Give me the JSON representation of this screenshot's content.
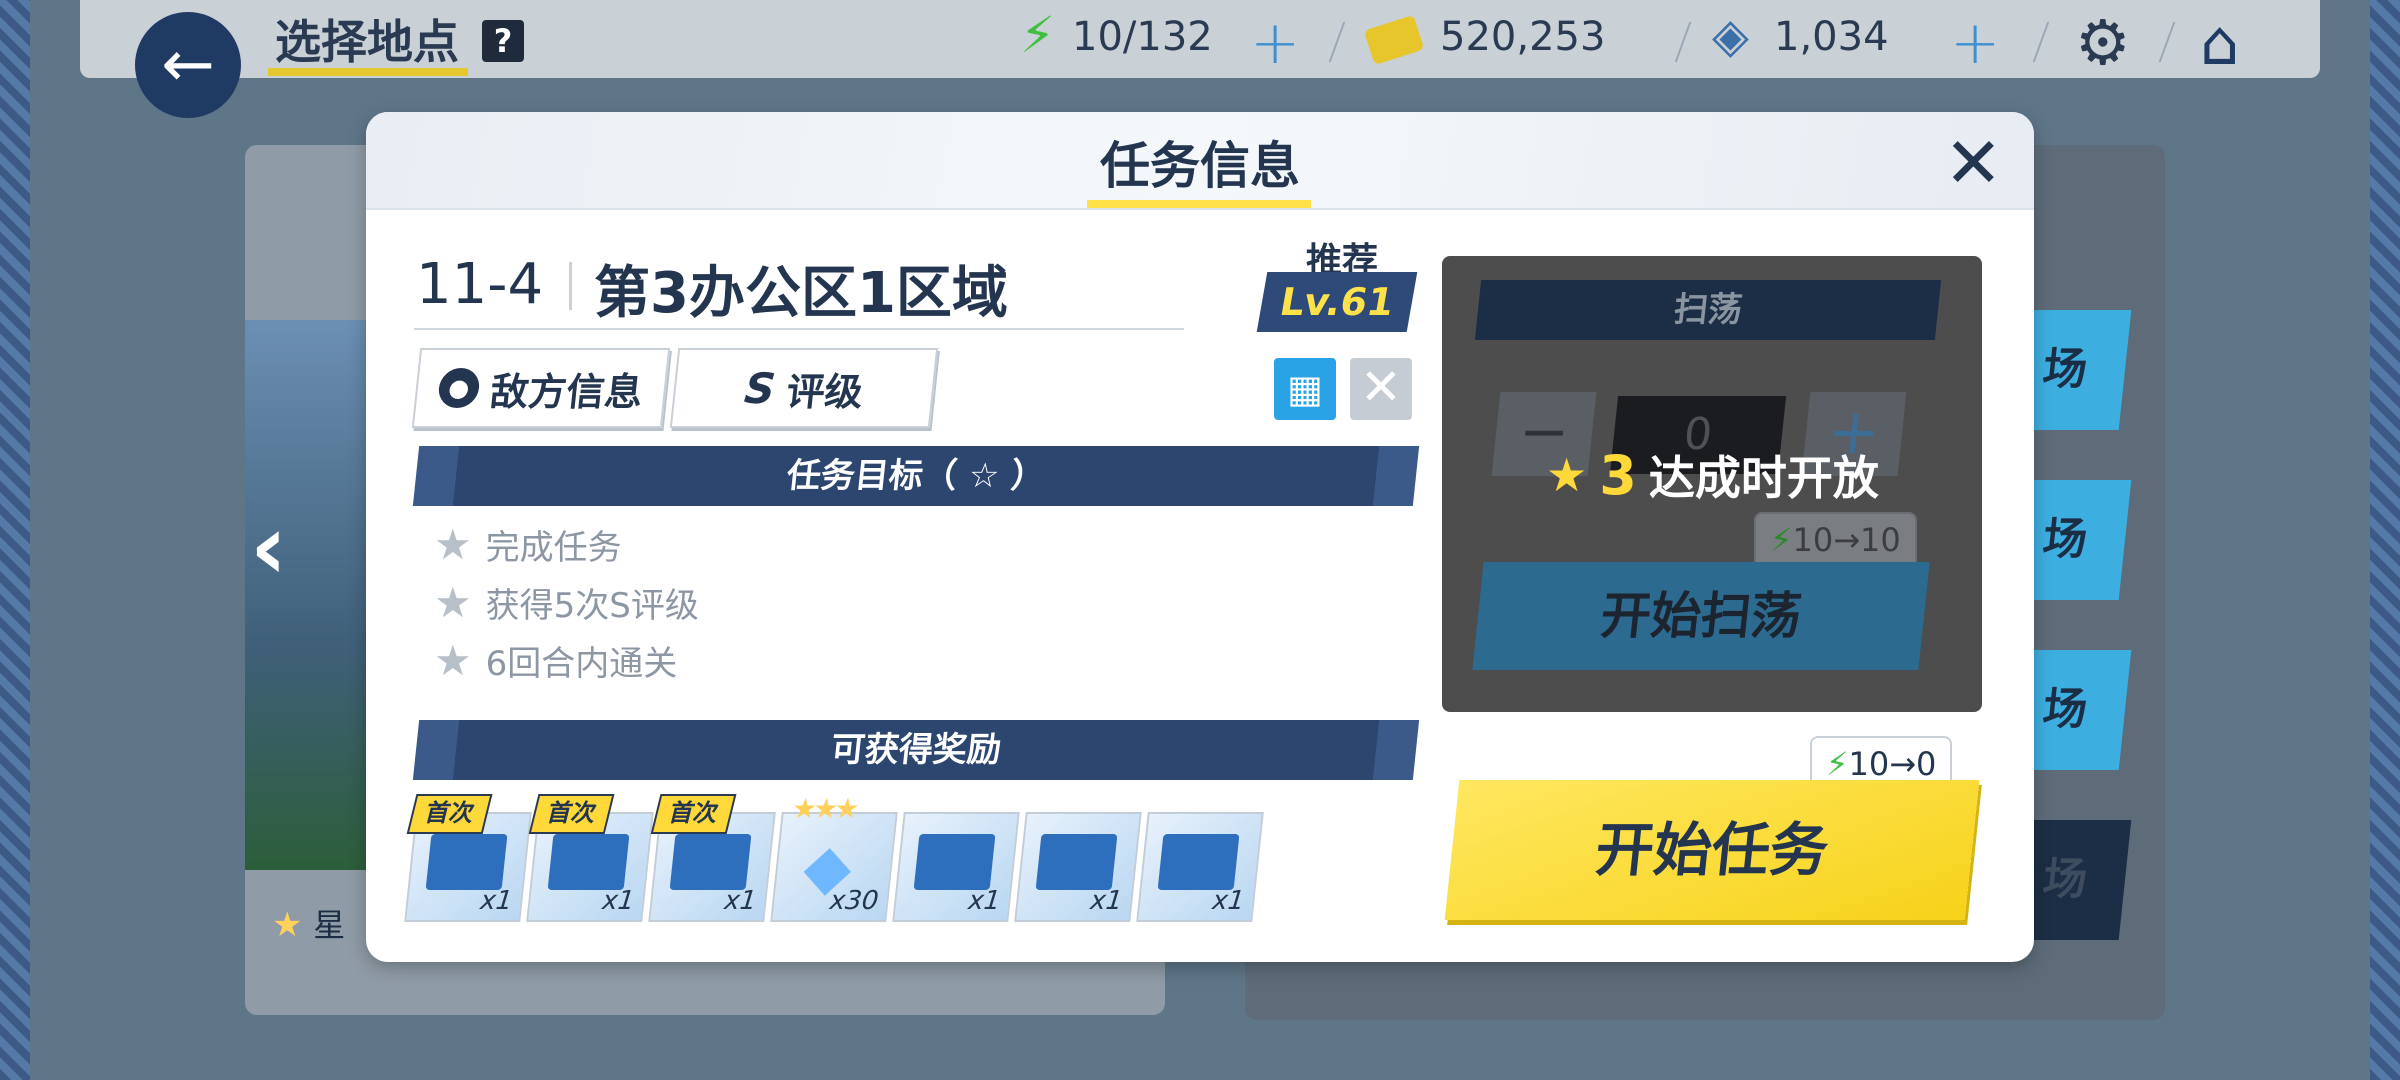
{
  "topbar": {
    "location_title": "选择地点",
    "help_icon": "?",
    "ap": "10/132",
    "credits": "520,253",
    "gems": "1,034"
  },
  "background": {
    "left_star_label": "星",
    "right_button_label": "场"
  },
  "modal": {
    "title": "任务信息",
    "stage_code": "11-4",
    "stage_name": "第3办公区1区域",
    "recommended_label": "推荐",
    "recommended_level": "Lv.61",
    "enemy_info_label": "敌方信息",
    "rank_letter": "S",
    "rank_label": "评级",
    "objectives_header": "任务目标（ ☆ ）",
    "objectives": [
      "完成任务",
      "获得5次S评级",
      "6回合内通关"
    ],
    "rewards_header": "可获得奖励",
    "first_clear_label": "首次",
    "rewards": [
      {
        "qty": "x1",
        "first": true
      },
      {
        "qty": "x1",
        "first": true
      },
      {
        "qty": "x1",
        "first": true
      },
      {
        "qty": "x30",
        "first": false,
        "stars": "★★★"
      },
      {
        "qty": "x1",
        "first": false
      },
      {
        "qty": "x1",
        "first": false
      },
      {
        "qty": "x1",
        "first": false
      }
    ]
  },
  "sweep": {
    "header": "扫荡",
    "count": "0",
    "unlock_stars": "3",
    "unlock_text": "达成时开放",
    "ap_cost": "10→10",
    "button_label": "开始扫荡"
  },
  "start": {
    "ap_cost": "10→0",
    "button_label": "开始任务"
  },
  "colors": {
    "accent_yellow": "#ffe24a",
    "navy": "#24364f",
    "ap_green": "#3fbf3f"
  },
  "icons": [
    "back-arrow-icon",
    "help-icon",
    "ap-bolt-icon",
    "credit-card-icon",
    "gem-icon",
    "gear-icon",
    "home-icon",
    "close-icon",
    "enemy-icon",
    "terrain-icon",
    "star-icon"
  ]
}
